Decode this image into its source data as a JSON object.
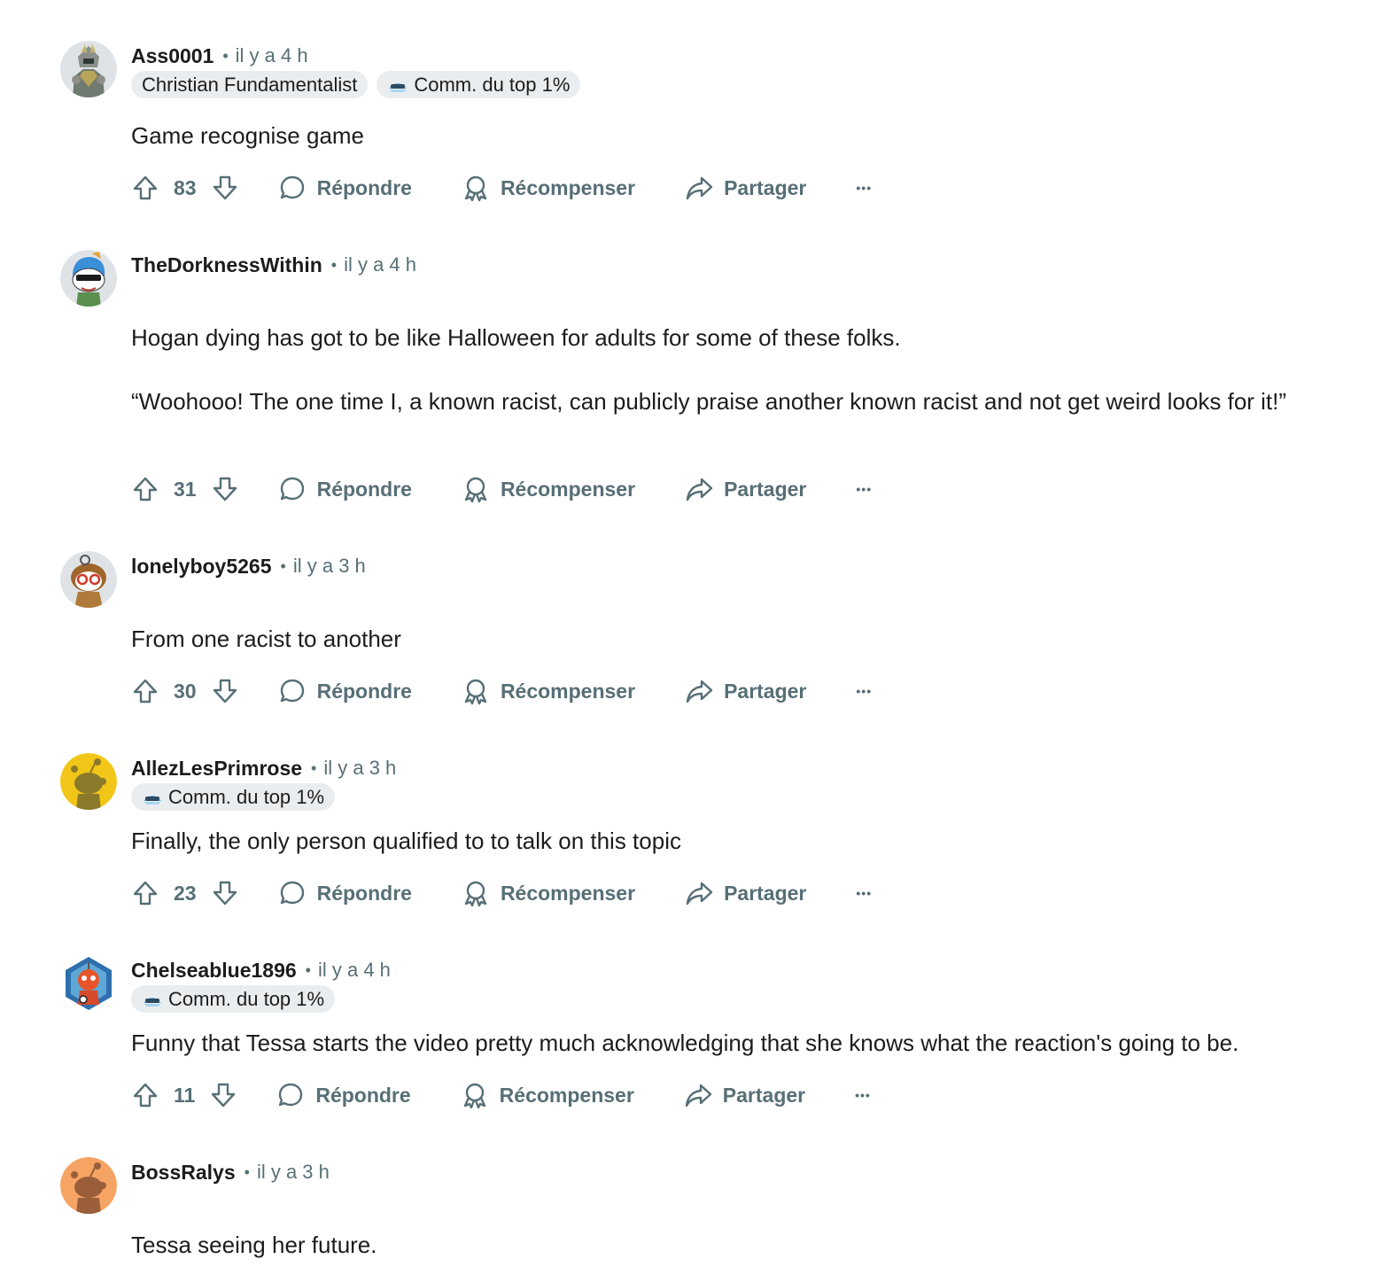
{
  "labels": {
    "reply": "Répondre",
    "award": "Récompenser",
    "share": "Partager",
    "more": "•••"
  },
  "comments": [
    {
      "author": "Ass0001",
      "time": "il y a 4 h",
      "flairs": [
        "Christian Fundamentalist",
        "Comm. du top 1%"
      ],
      "body": [
        "Game recognise game"
      ],
      "votes": "83",
      "avatar": "armored-knight-avatar"
    },
    {
      "author": "TheDorknessWithin",
      "time": "il y a 4 h",
      "flairs": [],
      "body": [
        "Hogan dying has got to be like Halloween for adults for some of these folks.",
        "“Woohooo! The one time I, a known racist, can publicly praise another known racist and not get weird looks for it!”"
      ],
      "votes": "31",
      "avatar": "sunglasses-snoo-avatar"
    },
    {
      "author": "lonelyboy5265",
      "time": "il y a 3 h",
      "flairs": [],
      "body": [
        "From one racist to another"
      ],
      "votes": "30",
      "avatar": "glasses-snoo-avatar"
    },
    {
      "author": "AllezLesPrimrose",
      "time": "il y a 3 h",
      "flairs": [
        "Comm. du top 1%"
      ],
      "body": [
        "Finally, the only person qualified to to talk on this topic"
      ],
      "votes": "23",
      "avatar": "default-snoo-yellow-avatar"
    },
    {
      "author": "Chelseablue1896",
      "time": "il y a 4 h",
      "flairs": [
        "Comm. du top 1%"
      ],
      "body": [
        "Funny that Tessa starts the video pretty much acknowledging that she knows what the reaction's going to be."
      ],
      "votes": "11",
      "avatar": "robot-snoo-hexagon-avatar"
    },
    {
      "author": "BossRalys",
      "time": "il y a 3 h",
      "flairs": [],
      "body": [
        "Tessa seeing her future."
      ],
      "votes": "",
      "avatar": "default-snoo-orange-avatar"
    }
  ],
  "colors": {
    "meta_gray": "#576f76",
    "flair_bg": "#eaedef",
    "text": "#1c1c1c"
  }
}
